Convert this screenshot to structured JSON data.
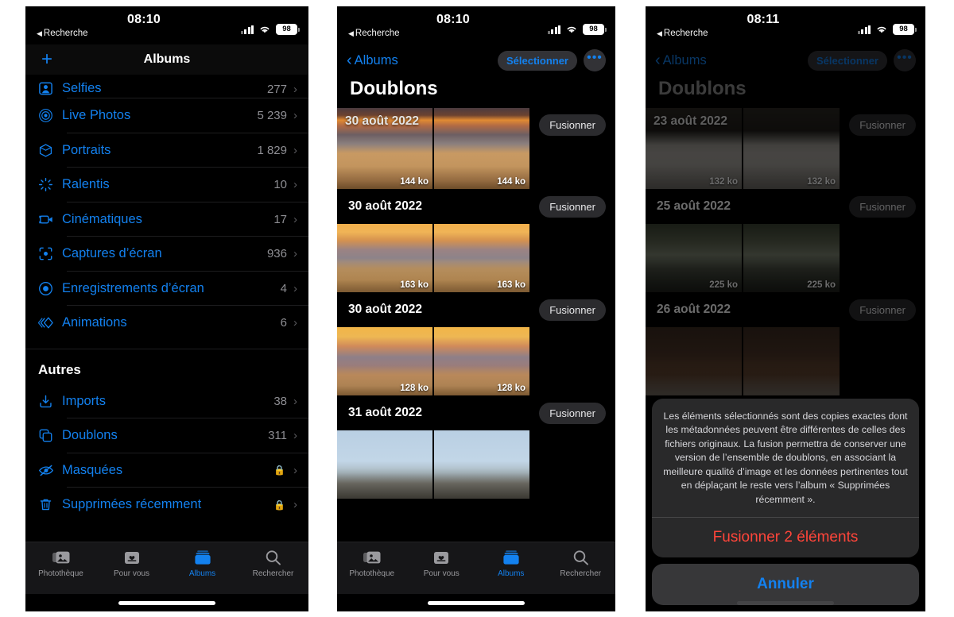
{
  "screens": [
    {
      "id": "albums-list",
      "status": {
        "time": "08:10",
        "back": "Recherche",
        "battery": "98"
      },
      "navbar": {
        "title": "Albums",
        "add_label": "+"
      },
      "list_items": [
        {
          "label": "Selfies",
          "count": "277",
          "icon": "person-portrait-icon"
        },
        {
          "label": "Live Photos",
          "count": "5 239",
          "icon": "live-photo-icon"
        },
        {
          "label": "Portraits",
          "count": "1 829",
          "icon": "cube-icon"
        },
        {
          "label": "Ralentis",
          "count": "10",
          "icon": "slow-motion-icon"
        },
        {
          "label": "Cinématiques",
          "count": "17",
          "icon": "cinematic-video-icon"
        },
        {
          "label": "Captures d’écran",
          "count": "936",
          "icon": "screenshot-icon"
        },
        {
          "label": "Enregistrements d’écran",
          "count": "4",
          "icon": "screen-record-icon"
        },
        {
          "label": "Animations",
          "count": "6",
          "icon": "animation-icon"
        }
      ],
      "section_title": "Autres",
      "other_items": [
        {
          "label": "Imports",
          "count": "38",
          "icon": "import-icon",
          "locked": false
        },
        {
          "label": "Doublons",
          "count": "311",
          "icon": "duplicate-icon",
          "locked": false
        },
        {
          "label": "Masquées",
          "count": "",
          "icon": "hidden-eye-icon",
          "locked": true
        },
        {
          "label": "Supprimées récemment",
          "count": "",
          "icon": "trash-icon",
          "locked": true
        }
      ],
      "tabs": [
        {
          "label": "Photothèque",
          "icon": "photos-library-icon",
          "active": false
        },
        {
          "label": "Pour vous",
          "icon": "for-you-icon",
          "active": false
        },
        {
          "label": "Albums",
          "icon": "albums-icon",
          "active": true
        },
        {
          "label": "Rechercher",
          "icon": "search-icon",
          "active": false
        }
      ]
    },
    {
      "id": "duplicates-list",
      "status": {
        "time": "08:10",
        "back": "Recherche",
        "battery": "98"
      },
      "navbar": {
        "back_label": "Albums",
        "select_label": "Sélectionner",
        "more_label": "•••",
        "title": "Doublons"
      },
      "groups": [
        {
          "date": "30 août 2022",
          "merge_label": "Fusionner",
          "size": "144 ko",
          "art": "sunset1"
        },
        {
          "date": "30 août 2022",
          "merge_label": "Fusionner",
          "size": "163 ko",
          "art": "sunset2"
        },
        {
          "date": "30 août 2022",
          "merge_label": "Fusionner",
          "size": "128 ko",
          "art": "sunset3"
        },
        {
          "date": "31 août 2022",
          "merge_label": "Fusionner",
          "size": "",
          "art": "bird"
        }
      ],
      "tabs": [
        {
          "label": "Photothèque",
          "icon": "photos-library-icon",
          "active": false
        },
        {
          "label": "Pour vous",
          "icon": "for-you-icon",
          "active": false
        },
        {
          "label": "Albums",
          "icon": "albums-icon",
          "active": true
        },
        {
          "label": "Rechercher",
          "icon": "search-icon",
          "active": false
        }
      ]
    },
    {
      "id": "duplicates-merge-sheet",
      "status": {
        "time": "08:11",
        "back": "Recherche",
        "battery": "98"
      },
      "navbar": {
        "back_label": "Albums",
        "select_label": "Sélectionner",
        "more_label": "•••",
        "title": "Doublons"
      },
      "groups": [
        {
          "date": "23 août 2022",
          "merge_label": "Fusionner",
          "size": "132 ko",
          "art": "dogtile"
        },
        {
          "date": "25 août 2022",
          "merge_label": "Fusionner",
          "size": "225 ko",
          "art": "fence"
        },
        {
          "date": "26 août 2022",
          "merge_label": "Fusionner",
          "size": "",
          "art": "dogface"
        }
      ],
      "sheet": {
        "message": "Les éléments sélectionnés sont des copies exactes dont les métadonnées peuvent être différentes de celles des fichiers originaux. La fusion permettra de conserver une version de l’ensemble de doublons, en associant la meilleure qualité d’image et les données pertinentes tout en déplaçant le reste vers l’album « Supprimées récemment ».",
        "confirm_label": "Fusionner 2 éléments",
        "cancel_label": "Annuler",
        "confirm_color": "#ff453a",
        "cancel_color": "#1381ef"
      }
    }
  ],
  "colors": {
    "accent": "#1381ef",
    "destructive": "#ff453a",
    "secondary_text": "#8e8e93"
  }
}
